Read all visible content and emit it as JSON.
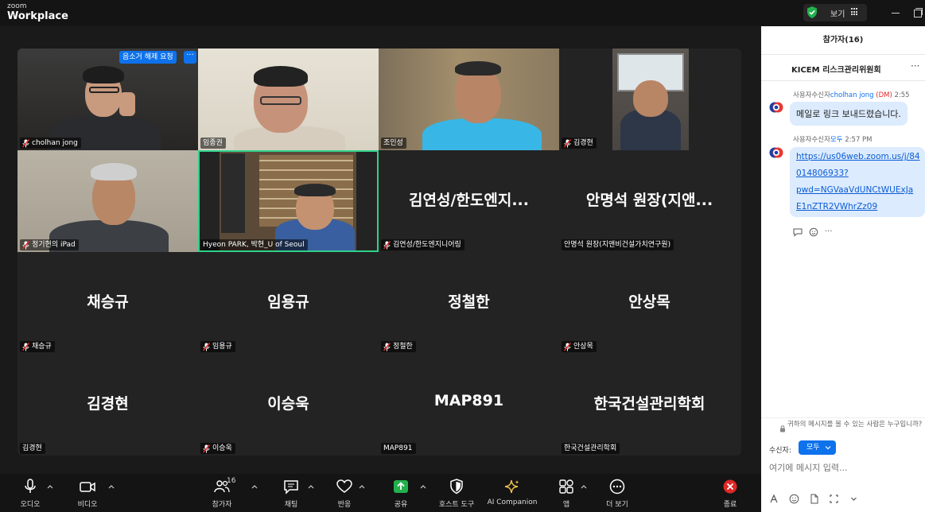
{
  "app": {
    "brand_small": "zoom",
    "brand_large": "Workplace"
  },
  "titlebar": {
    "view_label": "보기"
  },
  "gallery": {
    "mute_request_label": "음소거 해제 요청",
    "mute_request_more": "···",
    "tiles": [
      {
        "name": "cholhan jong",
        "muted": true,
        "has_video": true
      },
      {
        "name": "임종권",
        "muted": false,
        "has_video": true
      },
      {
        "name": "조인성",
        "muted": false,
        "has_video": true
      },
      {
        "name": "김경현",
        "muted": true,
        "has_video": true
      },
      {
        "name": "정기현의 iPad",
        "muted": true,
        "has_video": true
      },
      {
        "name": "Hyeon PARK, 박현_U of Seoul",
        "muted": false,
        "has_video": true,
        "speaking": true
      },
      {
        "name": "김연성/한도엔지니어링",
        "big": "김연성/한도엔지...",
        "muted": true,
        "has_video": false
      },
      {
        "name": "안명석 원장(지앤비건설가치연구원)",
        "big": "안명석 원장(지앤...",
        "muted": false,
        "has_video": false
      },
      {
        "name": "채승규",
        "big": "채승규",
        "muted": true,
        "has_video": false
      },
      {
        "name": "임용규",
        "big": "임용규",
        "muted": true,
        "has_video": false
      },
      {
        "name": "정철한",
        "big": "정철한",
        "muted": true,
        "has_video": false
      },
      {
        "name": "안상목",
        "big": "안상목",
        "muted": true,
        "has_video": false
      },
      {
        "name": "김경현",
        "big": "김경현",
        "muted": false,
        "has_video": false
      },
      {
        "name": "이승욱",
        "big": "이승욱",
        "muted": true,
        "has_video": false
      },
      {
        "name": "MAP891",
        "big": "MAP891",
        "muted": false,
        "has_video": false
      },
      {
        "name": "한국건설관리학회",
        "big": "한국건설관리학회",
        "muted": false,
        "has_video": false
      }
    ]
  },
  "toolbar": {
    "audio": "오디오",
    "video": "비디오",
    "participants": "참가자",
    "participants_count": "16",
    "chat": "채팅",
    "reactions": "반응",
    "share": "공유",
    "host_tools": "호스트 도구",
    "ai_companion": "AI Companion",
    "apps": "앱",
    "more": "더 보기",
    "end": "종료"
  },
  "panel": {
    "header": "참가자(16)",
    "chat_title": "KICEM 리스크관리위원회",
    "messages": [
      {
        "prefix": "사용자수신자",
        "recipient": "cholhan jong",
        "dm": "(DM)",
        "time": "2:55",
        "text": "메일로 링크 보내드렸습니다."
      },
      {
        "prefix": "사용자수신자",
        "recipient": "모두",
        "time": "2:57 PM",
        "link_lines": [
          "https://us06web.zoom.us/j/84",
          "014806933?",
          "pwd=NGVaaVdUNCtWUExJa",
          "E1nZTR2VWhrZz09"
        ]
      }
    ],
    "notice": "귀하의 메시지를 볼 수 있는 사람은 누구입니까?",
    "recipient_label": "수신자:",
    "recipient_value": "모두",
    "input_placeholder": "여기에 메시지 입력..."
  },
  "colors": {
    "accent": "#0e72ed",
    "speaking": "#2fd28a",
    "muted_red": "#e02828",
    "share_green": "#22b14c"
  }
}
